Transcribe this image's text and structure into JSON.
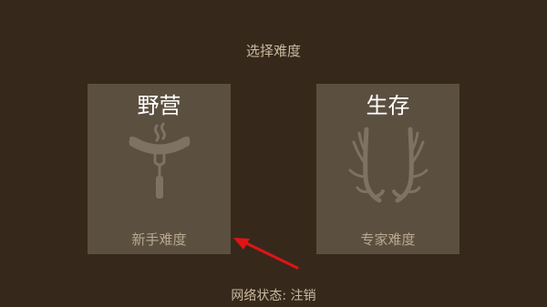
{
  "heading": "选择难度",
  "cards": [
    {
      "title": "野营",
      "subtitle": "新手难度",
      "icon": "sausage-on-fork-icon"
    },
    {
      "title": "生存",
      "subtitle": "专家难度",
      "icon": "antlers-icon"
    }
  ],
  "status": {
    "label": "网络状态:",
    "action": "注销"
  },
  "colors": {
    "background": "#36291c",
    "card": "#5b4f40",
    "icon": "#7d7263",
    "text": "#c9b99f",
    "arrow": "#e01414"
  }
}
